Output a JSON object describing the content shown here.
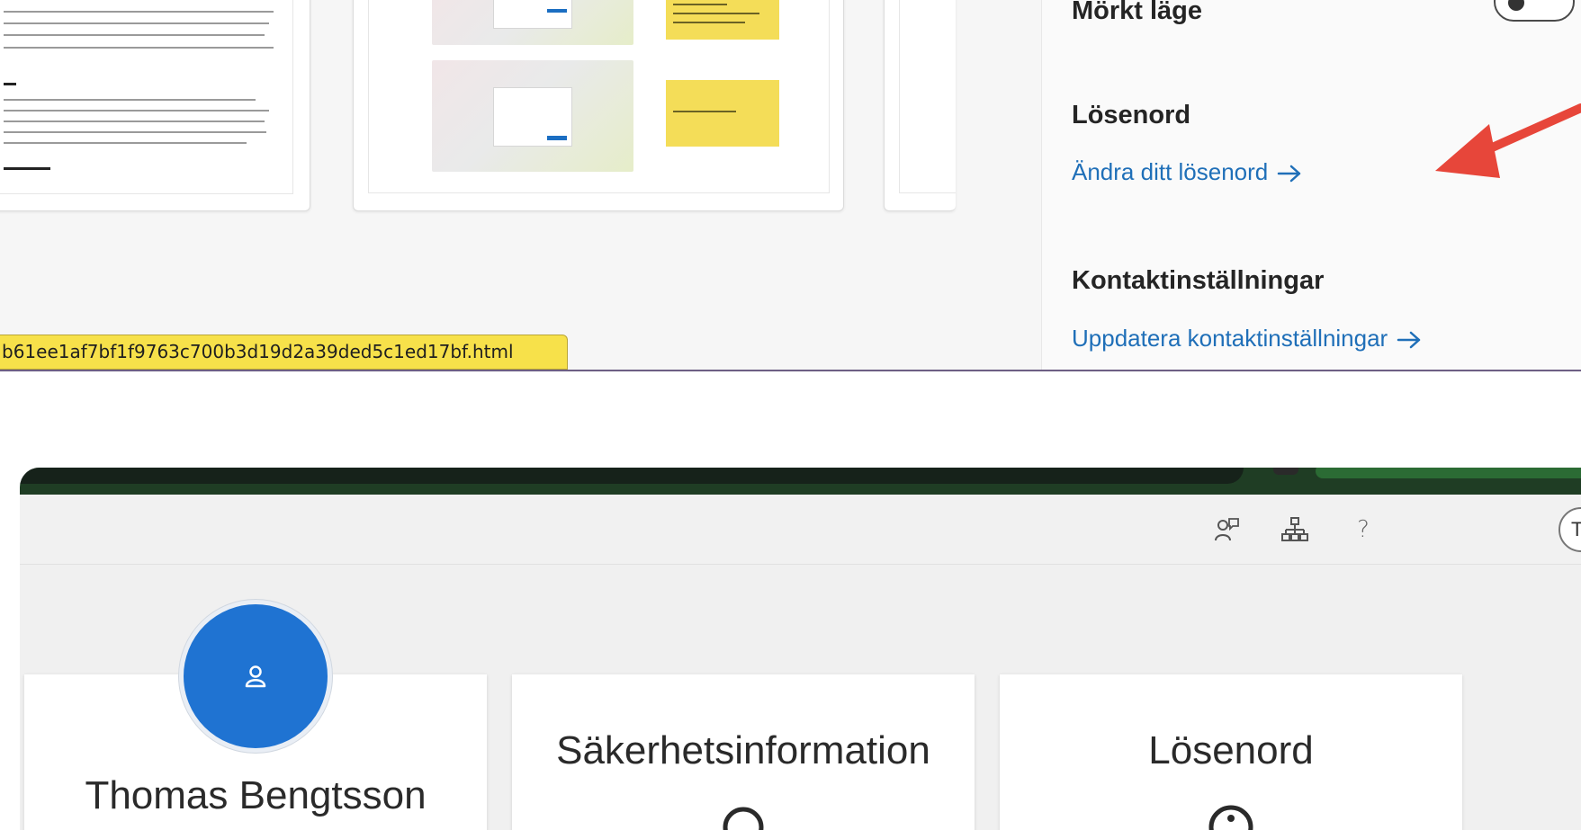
{
  "browser": {
    "status_url": "b61ee1af7bf1f9763c700b3d19d2a39ded5c1ed17bf.html"
  },
  "settings": {
    "dark_mode_label": "Mörkt läge",
    "password_heading": "Lösenord",
    "password_link": "Ändra ditt lösenord",
    "contact_heading": "Kontaktinställningar",
    "contact_link": "Uppdatera kontaktinställningar",
    "dark_mode_enabled": false
  },
  "app": {
    "toolbar_icons": [
      "feedback-person-icon",
      "org-chart-icon",
      "help-icon"
    ],
    "avatar_initial": "T",
    "profile_name": "Thomas Bengtsson",
    "cards": [
      {
        "title": "Säkerhetsinformation",
        "icon": "search-icon"
      },
      {
        "title": "Lösenord",
        "icon": "key-icon"
      }
    ]
  },
  "colors": {
    "link": "#1f6fb8",
    "tag_yellow": "#f7e14a",
    "avatar_blue": "#1f73d2",
    "annotation_red": "#e7463a"
  }
}
